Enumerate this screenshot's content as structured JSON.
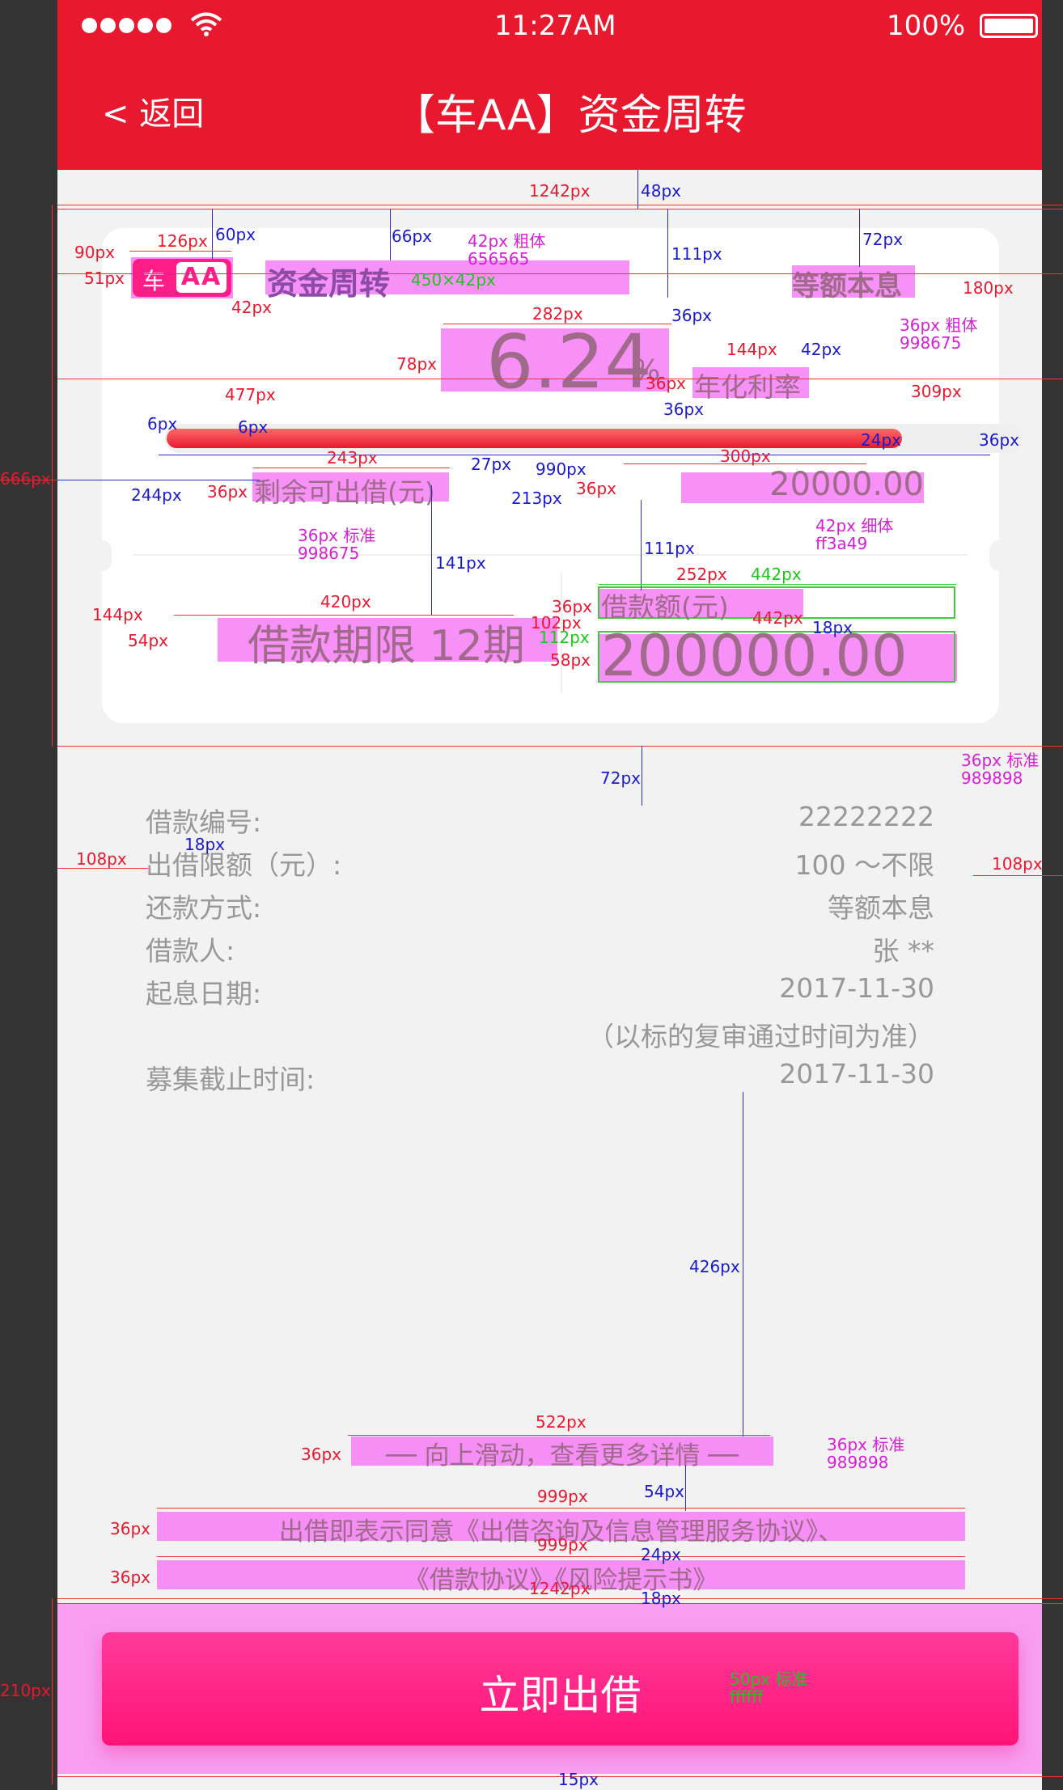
{
  "status_bar": {
    "time": "11:27AM",
    "battery": "100%"
  },
  "nav": {
    "back_label": "< 返回",
    "title": "【车AA】资金周转"
  },
  "card": {
    "badge_left": "车",
    "badge_right": "AA",
    "product_name": "资金周转",
    "repay_method": "等额本息",
    "rate": "6.24",
    "rate_unit": "%",
    "rate_label": "年化利率",
    "progress": 0.86,
    "remaining_label": "剩余可出借(元)",
    "remaining_value": "20000.00",
    "term": "借款期限 12期",
    "loan_amount_label": "借款额(元)",
    "loan_amount_value": "200000.00"
  },
  "details": [
    {
      "label": "借款编号:",
      "value": "22222222"
    },
    {
      "label": "出借限额（元）:",
      "value": "100 ～不限"
    },
    {
      "label": "还款方式:",
      "value": "等额本息"
    },
    {
      "label": "借款人:",
      "value": "张 **"
    },
    {
      "label": "起息日期:",
      "value": "2017-11-30"
    },
    {
      "label": "",
      "value": "（以标的复审通过时间为准）"
    },
    {
      "label": "募集截止时间:",
      "value": "2017-11-30"
    }
  ],
  "scroll_hint": "── 向上滑动，查看更多详情 ──",
  "agreement": {
    "line1": "出借即表示同意《出借咨询及信息管理服务协议》、",
    "line2": "《借款协议》《风险提示书》"
  },
  "cta_label": "立即出借",
  "colors": {
    "brand_red": "#e8192f",
    "button_pink": "#ff1e88",
    "muted_text": "#989898",
    "value_pink": "#ff3a49",
    "annotation_magenta": "#f578f5"
  },
  "annotations": {
    "w1242a": "1242px",
    "h48": "48px",
    "h60": "60px",
    "h66": "66px",
    "h72": "72px",
    "h111a": "111px",
    "w90": "90px",
    "w126": "126px",
    "h51": "51px",
    "w42": "42px",
    "spec_title": "42px 粗体",
    "spec_title_color": "656565",
    "size_450": "450×42px",
    "w180": "180px",
    "h36a": "36px",
    "spec_method": "36px 粗体",
    "spec_method_color": "998675",
    "w282": "282px",
    "h78": "78px",
    "w477": "477px",
    "w144a": "144px",
    "h42": "42px",
    "w36b": "36px",
    "w309": "309px",
    "h36c": "36px",
    "w6a": "6px",
    "w6b": "6px",
    "h24": "24px",
    "h36d": "36px",
    "w243": "243px",
    "h27": "27px",
    "w990": "990px",
    "w300": "300px",
    "w666": "666px",
    "w244": "244px",
    "h36e": "36px",
    "w213": "213px",
    "h36f": "36px",
    "spec_label": "36px 标准",
    "spec_label_color": "998675",
    "spec_value": "42px 细体",
    "spec_value_color": "ff3a49",
    "h141": "141px",
    "h111b": "111px",
    "w144b": "144px",
    "w420": "420px",
    "h54": "54px",
    "w252": "252px",
    "w442a": "442px",
    "h36g": "36px",
    "w102": "102px",
    "h112": "112px",
    "w442b": "442px",
    "h18a": "18px",
    "h58": "58px",
    "spec_detail": "36px 标准",
    "spec_detail_color": "989898",
    "h72b": "72px",
    "w108a": "108px",
    "w108b": "108px",
    "h18b": "18px",
    "h426": "426px",
    "w522": "522px",
    "h36h": "36px",
    "spec_hint": "36px 标准",
    "spec_hint_color": "989898",
    "h54b": "54px",
    "w999a": "999px",
    "h36i": "36px",
    "w999b": "999px",
    "h24b": "24px",
    "h36j": "36px",
    "w1242b": "1242px",
    "h18c": "18px",
    "h210": "210px",
    "spec_btn": "50px 标准",
    "spec_btn_color": "ffffff",
    "h15": "15px"
  }
}
